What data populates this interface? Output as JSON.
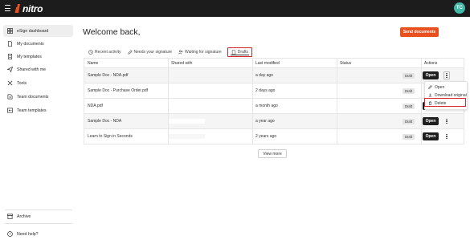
{
  "header": {
    "logo_text": "nitro",
    "avatar_initials": "TC",
    "brand_color": "#e8501f"
  },
  "sidebar": {
    "items": [
      {
        "label": "eSign dashboard",
        "icon": "grid-icon"
      },
      {
        "label": "My documents",
        "icon": "document-icon"
      },
      {
        "label": "My templates",
        "icon": "template-icon"
      },
      {
        "label": "Shared with me",
        "icon": "send-icon"
      },
      {
        "label": "Tools",
        "icon": "tools-icon"
      },
      {
        "label": "Team documents",
        "icon": "team-document-icon"
      },
      {
        "label": "Team templates",
        "icon": "team-template-icon"
      }
    ],
    "archive_label": "Archive",
    "help_label": "Need help?"
  },
  "main": {
    "welcome": "Welcome back,",
    "send_button": "Send documents",
    "tabs": [
      {
        "label": "Recent activity",
        "icon": "clock-icon"
      },
      {
        "label": "Needs your signature",
        "icon": "pen-icon"
      },
      {
        "label": "Waiting for signature",
        "icon": "people-icon"
      },
      {
        "label": "Drafts",
        "icon": "draft-icon"
      }
    ],
    "active_tab": "Drafts",
    "table": {
      "columns": [
        "Name",
        "Shared with",
        "Last modified",
        "Status",
        "Actions"
      ],
      "rows": [
        {
          "name": "Sample Doc - NDA.pdf",
          "last_modified": "a day ago",
          "status": "Draft"
        },
        {
          "name": "Sample Doc - Purchase Order.pdf",
          "last_modified": "2 days ago",
          "status": "Draft"
        },
        {
          "name": "NDA.pdf",
          "last_modified": "a month ago",
          "status": "Draft"
        },
        {
          "name": "Sample Doc - NDA",
          "last_modified": "a year ago",
          "status": "Draft"
        },
        {
          "name": "Learn to Sign in Seconds",
          "last_modified": "2 years ago",
          "status": "Draft"
        }
      ],
      "open_label": "Open"
    },
    "view_more": "View more",
    "dropdown": {
      "items": [
        {
          "label": "Open",
          "icon": "pencil-icon"
        },
        {
          "label": "Download original",
          "icon": "download-icon"
        },
        {
          "label": "Delete",
          "icon": "trash-icon"
        }
      ]
    }
  }
}
